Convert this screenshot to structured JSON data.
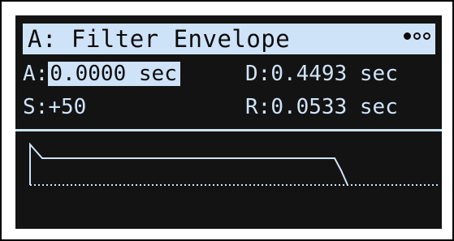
{
  "header": {
    "title": "A: Filter Envelope",
    "page_indicator": {
      "current": 1,
      "total": 3
    }
  },
  "params": {
    "attack": {
      "label": "A:",
      "value": "0.0000 sec",
      "selected": true
    },
    "decay": {
      "label": "D:",
      "value": "0.4493 sec"
    },
    "sustain": {
      "label": "S:",
      "value": "+50"
    },
    "release": {
      "label": "R:",
      "value": "0.0533 sec"
    }
  },
  "colors": {
    "display_bg": "#131313",
    "display_fg": "#cfe3f8"
  }
}
